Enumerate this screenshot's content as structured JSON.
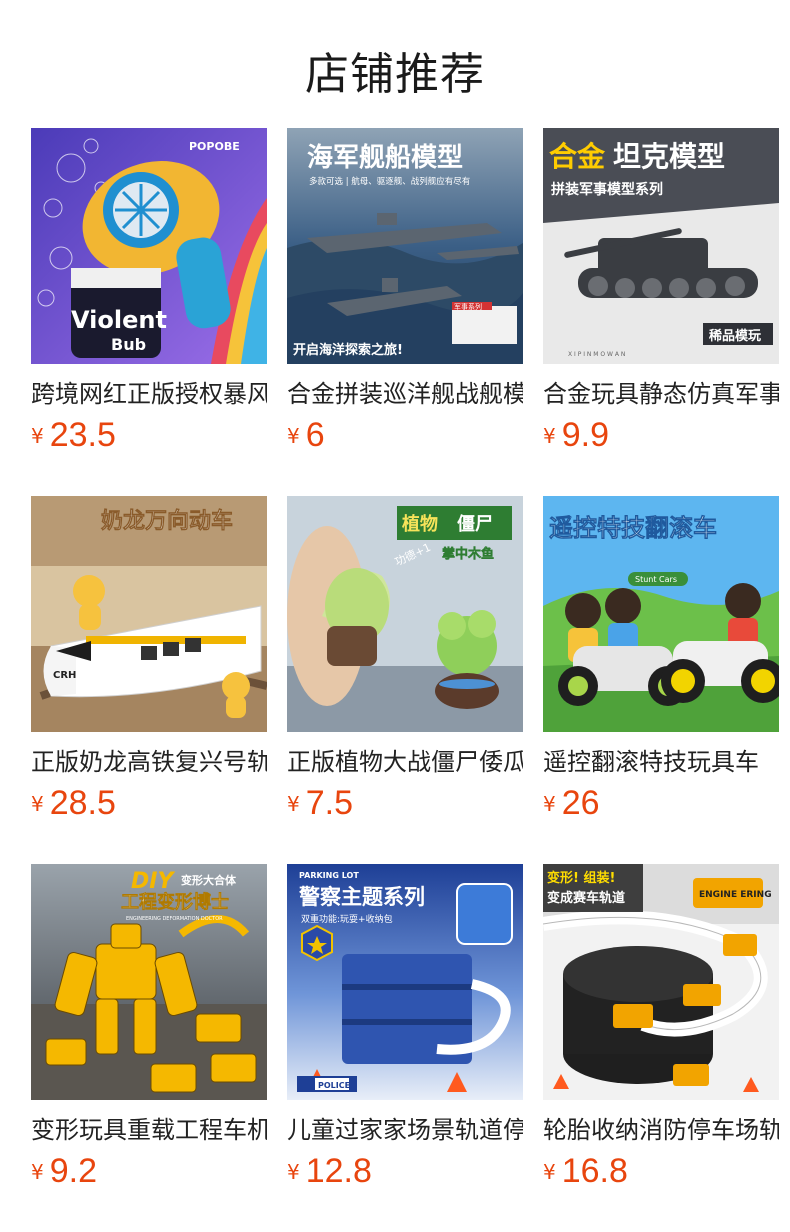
{
  "header": {
    "title": "店铺推荐"
  },
  "currency_symbol": "¥",
  "products": [
    {
      "name": "跨境网红正版授权暴风泡泡机",
      "price": "23.5",
      "image": {
        "headline": "",
        "brand": "POPOBE",
        "can_text": "Violent",
        "can_text2": "Bub",
        "colors": [
          "#6a5bd8",
          "#f2b632",
          "#2aa3d6"
        ]
      }
    },
    {
      "name": "合金拼装巡洋舰战舰模型",
      "price": "6",
      "image": {
        "headline": "海军舰船模型",
        "subline": "多款可选 | 航母、驱逐舰、战列舰应有尽有",
        "footer": "开启海洋探索之旅!",
        "tag": "军事系列",
        "colors": [
          "#3b5f86",
          "#2d4a66",
          "#9aa6b0"
        ]
      }
    },
    {
      "name": "合金玩具静态仿真军事坦克",
      "price": "9.9",
      "image": {
        "headline": "合金",
        "headline2": "坦克模型",
        "subline": "拼装军事模型系列",
        "badge": "稀品模玩",
        "footer_letters": "X I P I N M O W A N",
        "colors": [
          "#ffcc00",
          "#3a3d42",
          "#e6e6e6"
        ]
      }
    },
    {
      "name": "正版奶龙高铁复兴号轨道车",
      "price": "28.5",
      "image": {
        "headline": "奶龙万向动车",
        "train_text": "CRH",
        "colors": [
          "#f3d9a8",
          "#ffffff",
          "#f0b400"
        ]
      }
    },
    {
      "name": "正版植物大战僵尸倭瓜解压",
      "price": "7.5",
      "image": {
        "headline": "植物",
        "headline2": "僵尸",
        "subline": "掌中木鱼",
        "caption": "功德+1",
        "colors": [
          "#7fbf46",
          "#f6e35a",
          "#c8d9e6"
        ]
      }
    },
    {
      "name": "遥控翻滚特技玩具车",
      "price": "26",
      "image": {
        "headline": "遥控特技翻滚车",
        "tag": "Stunt Cars",
        "colors": [
          "#4aa3e8",
          "#6cc04a",
          "#a8d64a"
        ]
      }
    },
    {
      "name": "变形玩具重载工程车机器人",
      "price": "9.2",
      "image": {
        "headline": "DIY",
        "headline2": "变形大合体",
        "subline": "工程变形博士",
        "caption": "ENGINEERING DEFORMATION DOCTOR",
        "colors": [
          "#f5b800",
          "#5a5a5a",
          "#2e2e2e"
        ]
      }
    },
    {
      "name": "儿童过家家场景轨道停车场",
      "price": "12.8",
      "image": {
        "top_label": "PARKING LOT",
        "headline": "警察主题系列",
        "subline": "双重功能:玩耍+收纳包",
        "badge": "POLICE",
        "colors": [
          "#2b4fa8",
          "#8fb1e6",
          "#e8eef8"
        ]
      }
    },
    {
      "name": "轮胎收纳消防停车场轨道",
      "price": "16.8",
      "image": {
        "headline": "变形! 组装!",
        "headline2": "变成赛车轨道",
        "sign": "ENGINE ERING",
        "colors": [
          "#e8e8e8",
          "#222222",
          "#f2a400"
        ]
      }
    }
  ]
}
